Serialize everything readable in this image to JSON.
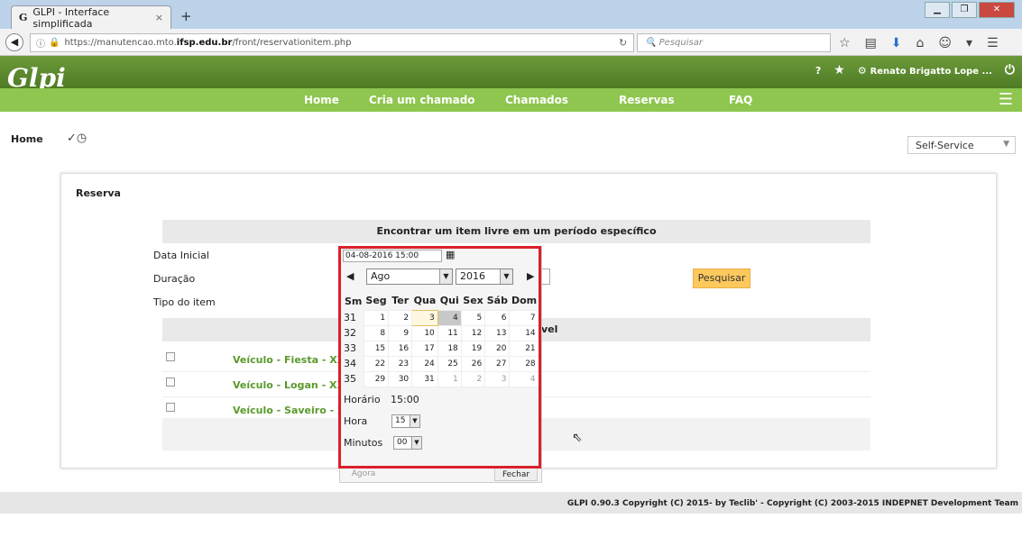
{
  "browser": {
    "tab_title": "GLPI - Interface simplificada",
    "tab_close": "×",
    "new_tab": "+",
    "url_prefix": "https://manutencao.mto.",
    "url_host": "ifsp.edu.br",
    "url_path": "/front/reservationitem.php",
    "search_placeholder": "Pesquisar"
  },
  "header": {
    "logo": "Glpi",
    "help": "?",
    "user": "Renato Brigatto Lope ...",
    "menu": [
      "Home",
      "Cria um chamado",
      "Chamados",
      "Reservas",
      "FAQ"
    ]
  },
  "breadcrumb": {
    "home": "Home"
  },
  "profile_select": "Self-Service",
  "form": {
    "section_title": "Reserva",
    "heading": "Encontrar um item livre em um período específico",
    "labels": [
      "Data Inicial",
      "Duração",
      "Tipo do item"
    ],
    "search_button": "Pesquisar",
    "list_heading_tail": "vel",
    "vehicles": [
      "Veículo - Fiesta - XXX-",
      "Veículo - Logan - XXX-",
      "Veículo - Saveiro - XX"
    ]
  },
  "datepicker": {
    "value": "04-08-2016 15:00",
    "month": "Ago",
    "year": "2016",
    "weekdays": [
      "Sm",
      "Seg",
      "Ter",
      "Qua",
      "Qui",
      "Sex",
      "Sáb",
      "Dom"
    ],
    "weeks": [
      {
        "wk": "31",
        "days": [
          "1",
          "2",
          "3",
          "4",
          "5",
          "6",
          "7"
        ]
      },
      {
        "wk": "32",
        "days": [
          "8",
          "9",
          "10",
          "11",
          "12",
          "13",
          "14"
        ]
      },
      {
        "wk": "33",
        "days": [
          "15",
          "16",
          "17",
          "18",
          "19",
          "20",
          "21"
        ]
      },
      {
        "wk": "34",
        "days": [
          "22",
          "23",
          "24",
          "25",
          "26",
          "27",
          "28"
        ]
      },
      {
        "wk": "35",
        "days": [
          "29",
          "30",
          "31",
          "1",
          "2",
          "3",
          "4"
        ]
      }
    ],
    "time_label": "Horário",
    "time_value": "15:00",
    "hour_label": "Hora",
    "hour_value": "15",
    "minutes_label": "Minutos",
    "minutes_value": "00",
    "now_button": "Agora",
    "close_button": "Fechar"
  },
  "footer": "GLPI 0.90.3 Copyright (C) 2015- by Teclib' - Copyright (C) 2003-2015 INDEPNET Development Team",
  "colors": {
    "green_dark": "#4f7b24",
    "green_light": "#8ec64f",
    "highlight": "#d9202c",
    "button": "#fec95c"
  }
}
